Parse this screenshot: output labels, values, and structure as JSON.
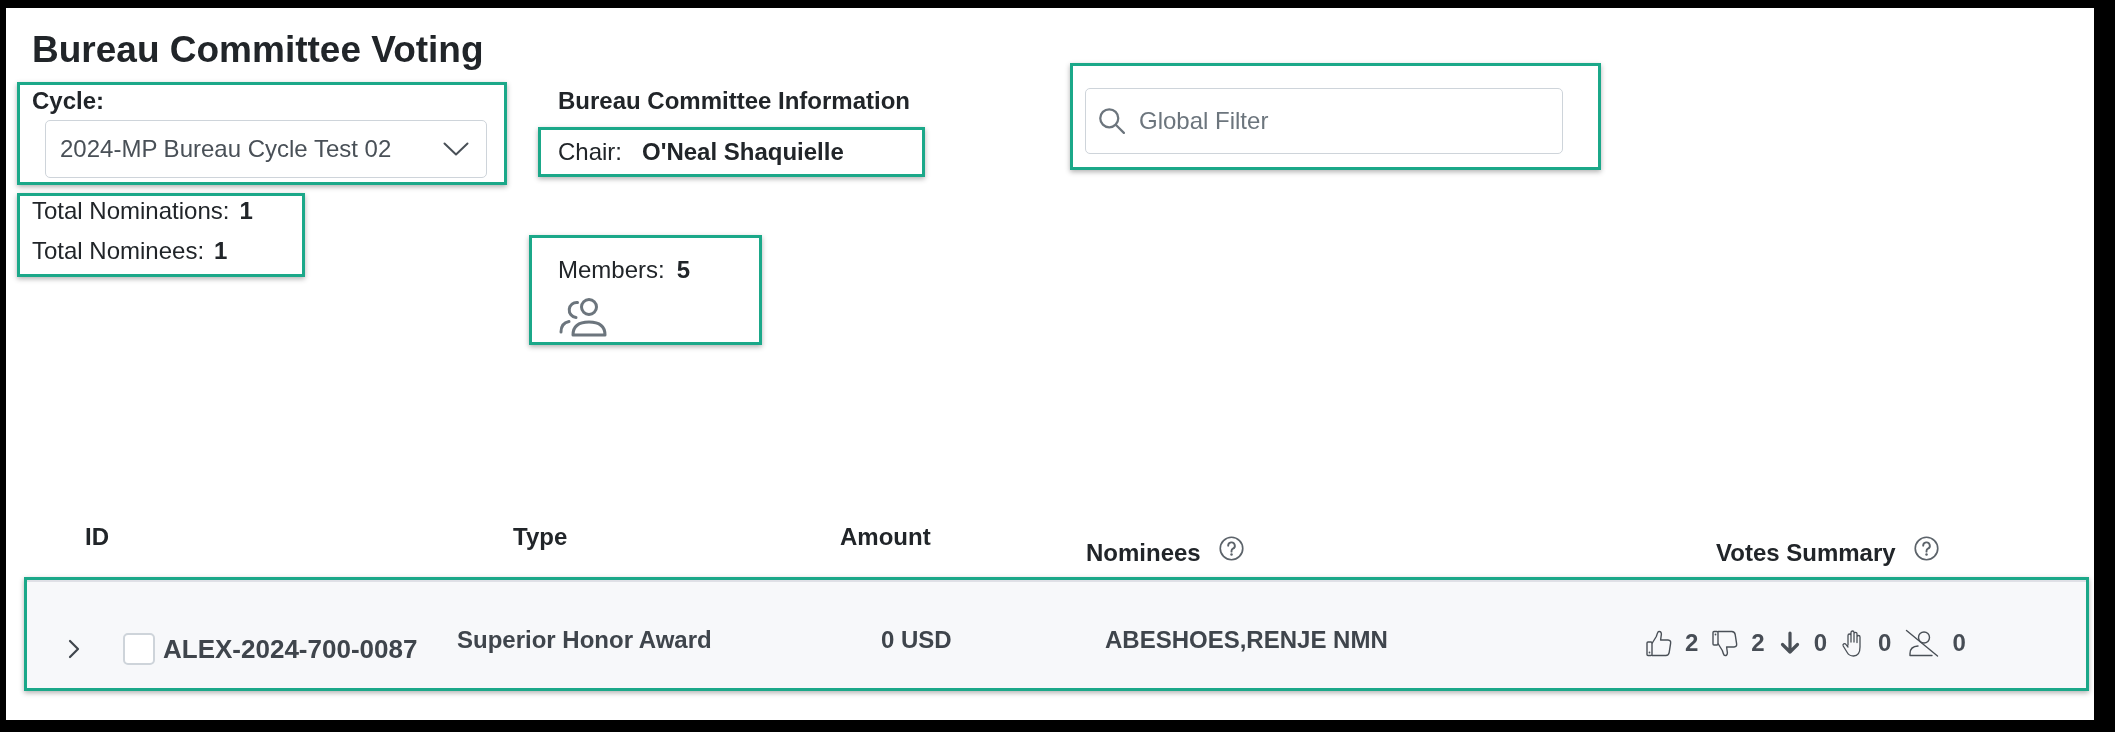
{
  "title": "Bureau Committee Voting",
  "cycle": {
    "label": "Cycle:",
    "value": "2024-MP Bureau Cycle Test 02",
    "highlighted": true
  },
  "totals": {
    "highlighted": true,
    "items": [
      {
        "label": "Total Nominations:",
        "value": "1"
      },
      {
        "label": "Total Nominees:",
        "value": "1"
      }
    ]
  },
  "committee": {
    "heading": "Bureau Committee Information",
    "chair": {
      "label": "Chair:",
      "value": "O'Neal Shaquielle",
      "highlighted": true
    },
    "members": {
      "label": "Members:",
      "value": "5",
      "highlighted": true
    }
  },
  "global_filter": {
    "placeholder": "Global Filter",
    "highlighted": true
  },
  "table": {
    "columns": [
      {
        "label": "ID",
        "help": false
      },
      {
        "label": "Type",
        "help": false
      },
      {
        "label": "Amount",
        "help": false
      },
      {
        "label": "Nominees",
        "help": true
      },
      {
        "label": "Votes Summary",
        "help": true
      }
    ],
    "rows": [
      {
        "highlighted": true,
        "expanded": false,
        "checked": false,
        "id": "ALEX-2024-700-0087",
        "type": "Superior Honor Award",
        "amount": "0 USD",
        "nominees": "ABESHOES,RENJE NMN",
        "votes": [
          {
            "kind": "approve",
            "count": "2"
          },
          {
            "kind": "disapprove",
            "count": "2"
          },
          {
            "kind": "downgrade",
            "count": "0"
          },
          {
            "kind": "abstain",
            "count": "0"
          },
          {
            "kind": "recuse",
            "count": "0"
          }
        ]
      }
    ]
  }
}
